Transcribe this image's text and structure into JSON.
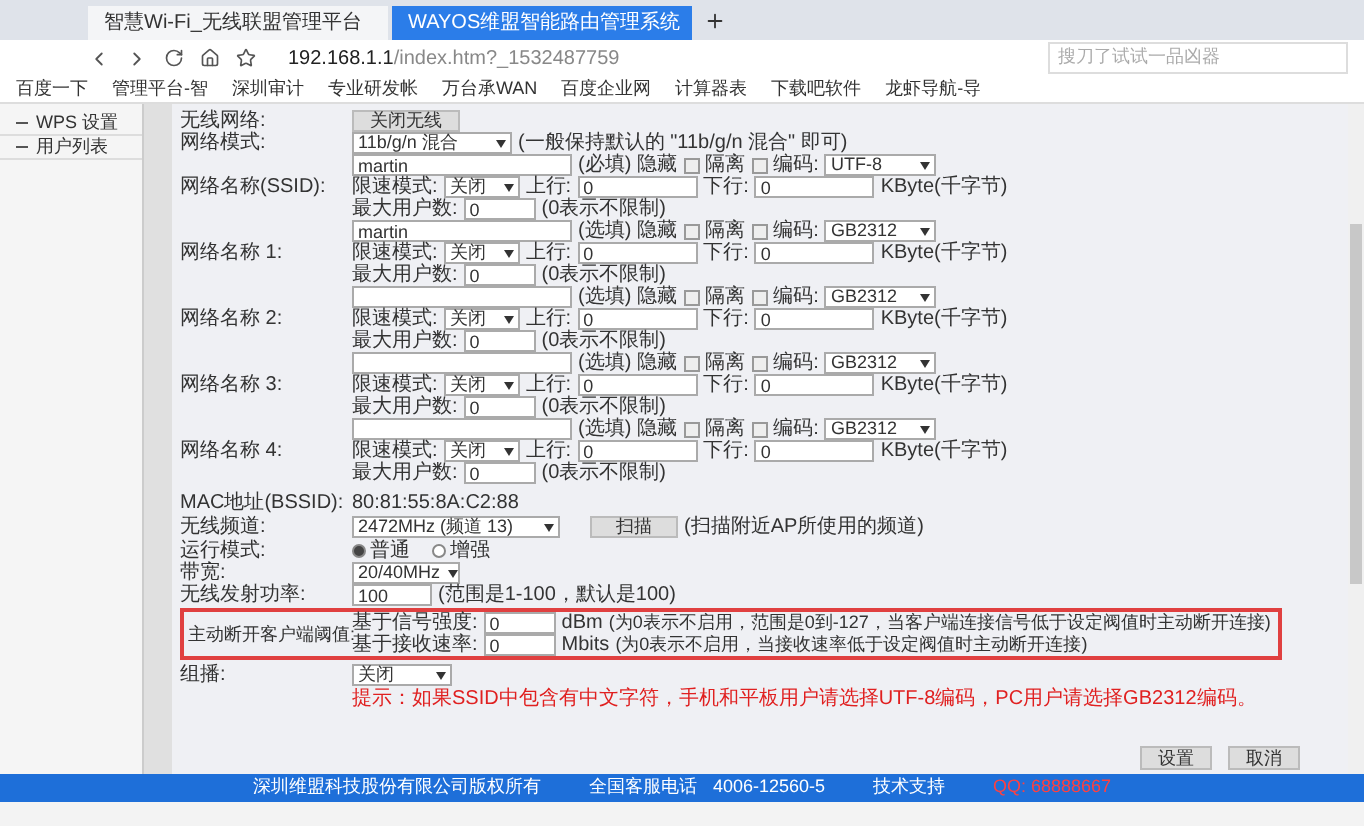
{
  "browser": {
    "tabs": [
      {
        "title": "智慧Wi-Fi_无线联盟管理平台",
        "selected": false
      },
      {
        "title": "WAYOS维盟智能路由管理系统",
        "selected": true
      }
    ],
    "url_host": "192.168.1.1",
    "url_path": "/index.htm?_1532487759",
    "search_placeholder": "搜刀了试试一品凶器",
    "bookmarks": [
      "百度一下",
      "管理平台-智",
      "深圳审计",
      "专业研发帐",
      "万台承WAN",
      "百度企业网",
      "计算器表",
      "下载吧软件",
      "龙虾导航-导"
    ]
  },
  "sidebar": {
    "items": [
      {
        "label": "WPS 设置",
        "selected": false
      },
      {
        "label": "用户列表",
        "selected": false
      }
    ]
  },
  "form": {
    "wireless_label": "无线网络:",
    "wireless_button": "关闭无线",
    "mode_label": "网络模式:",
    "mode_value": "11b/g/n 混合",
    "mode_hint": "(一般保持默认的 \"11b/g/n 混合\" 即可)",
    "networks": [
      {
        "label": "网络名称(SSID):",
        "name": "martin",
        "note": "(必填)",
        "hidden_label": "隐藏",
        "hidden": false,
        "isolate_label": "隔离",
        "isolate": false,
        "encoding_label": "编码:",
        "encoding": "UTF-8",
        "rate_label": "限速模式:",
        "rate_mode": "关闭",
        "up_label": "上行:",
        "up": "0",
        "down_label": "下行:",
        "down": "0",
        "unit": "KByte(千字节)",
        "max_label": "最大用户数:",
        "max_users": "0",
        "max_hint": "(0表示不限制)"
      },
      {
        "label": "网络名称 1:",
        "name": "martin",
        "note": "(选填)",
        "hidden_label": "隐藏",
        "hidden": false,
        "isolate_label": "隔离",
        "isolate": false,
        "encoding_label": "编码:",
        "encoding": "GB2312",
        "rate_label": "限速模式:",
        "rate_mode": "关闭",
        "up_label": "上行:",
        "up": "0",
        "down_label": "下行:",
        "down": "0",
        "unit": "KByte(千字节)",
        "max_label": "最大用户数:",
        "max_users": "0",
        "max_hint": "(0表示不限制)"
      },
      {
        "label": "网络名称 2:",
        "note": "(选填)",
        "hidden_label": "隐藏",
        "hidden": false,
        "isolate_label": "隔离",
        "isolate": false,
        "encoding_label": "编码:",
        "encoding": "GB2312",
        "rate_label": "限速模式:",
        "rate_mode": "关闭",
        "up_label": "上行:",
        "up": "0",
        "down_label": "下行:",
        "down": "0",
        "unit": "KByte(千字节)",
        "max_label": "最大用户数:",
        "max_users": "0",
        "max_hint": "(0表示不限制)"
      },
      {
        "label": "网络名称 3:",
        "note": "(选填)",
        "hidden_label": "隐藏",
        "hidden": false,
        "isolate_label": "隔离",
        "isolate": false,
        "encoding_label": "编码:",
        "encoding": "GB2312",
        "rate_label": "限速模式:",
        "rate_mode": "关闭",
        "up_label": "上行:",
        "up": "0",
        "down_label": "下行:",
        "down": "0",
        "unit": "KByte(千字节)",
        "max_label": "最大用户数:",
        "max_users": "0",
        "max_hint": "(0表示不限制)"
      },
      {
        "label": "网络名称 4:",
        "note": "(选填)",
        "hidden_label": "隐藏",
        "hidden": false,
        "isolate_label": "隔离",
        "isolate": false,
        "encoding_label": "编码:",
        "encoding": "GB2312",
        "rate_label": "限速模式:",
        "rate_mode": "关闭",
        "up_label": "上行:",
        "up": "0",
        "down_label": "下行:",
        "down": "0",
        "unit": "KByte(千字节)",
        "max_label": "最大用户数:",
        "max_users": "0",
        "max_hint": "(0表示不限制)"
      }
    ],
    "mac_label": "MAC地址(BSSID):",
    "mac": "80:81:55:8A:C2:88",
    "channel_label": "无线频道:",
    "channel": "2472MHz (频道 13)",
    "scan_button": "扫描",
    "scan_hint": "(扫描附近AP所使用的频道)",
    "run_label": "运行模式:",
    "run_modes": [
      {
        "label": "普通",
        "selected": true
      },
      {
        "label": "增强",
        "selected": false
      }
    ],
    "bw_label": "带宽:",
    "bw": "20/40MHz",
    "power_label": "无线发射功率:",
    "power": "100",
    "power_hint": "(范围是1-100，默认是100)",
    "kick_label": "主动断开客户端阈值:",
    "kick": [
      {
        "label": "基于信号强度:",
        "value": "0",
        "unit": "dBm",
        "hint": "(为0表示不启用，范围是0到-127，当客户端连接信号低于设定阀值时主动断开连接)"
      },
      {
        "label": "基于接收速率:",
        "value": "0",
        "unit": "Mbits",
        "hint": "(为0表示不启用，当接收速率低于设定阀值时主动断开连接)"
      }
    ],
    "mcast_label": "组播:",
    "mcast": "关闭",
    "tip": "提示：如果SSID中包含有中文字符，手机和平板用户请选择UTF-8编码，PC用户请选择GB2312编码。",
    "buttons": [
      "设置",
      "取消"
    ]
  },
  "footer": {
    "copyright": "深圳维盟科技股份有限公司版权所有",
    "phone_label": "全国客服电话",
    "phone": "4006-12560-5",
    "support": "技术支持",
    "qq": "QQ: 68888667"
  }
}
